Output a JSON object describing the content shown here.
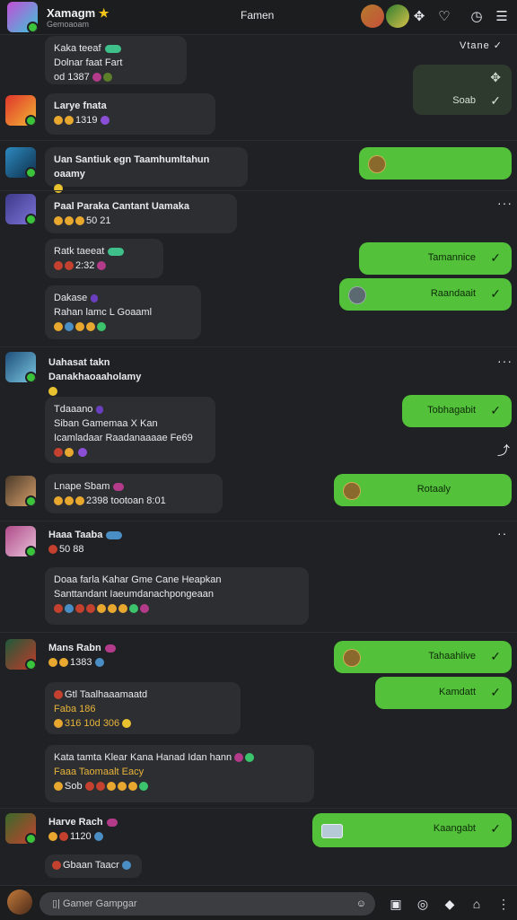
{
  "header": {
    "title": "Xamagm",
    "subtitle": "Gemoaoam",
    "center": "Famen",
    "time": "Vtane"
  },
  "rows": [
    {
      "name": "Kaka teeaf",
      "line2": "Dolnar faat Fart",
      "line3": "od 1387"
    },
    {
      "name": "Larye fnata",
      "sub": "1319"
    },
    {
      "name": "Uan Santiuk egn Taamhumltahun oaamy",
      "out": ""
    },
    {
      "name": "Paal Paraka Cantant Uamaka",
      "sub": "50 21"
    },
    {
      "name": "Ratk taeeat",
      "sub": "2:32",
      "out": "Tamannice"
    },
    {
      "name": "Dakase",
      "line2": "Rahan lamc L Goaaml",
      "out": "Raandaait"
    },
    {
      "name": "Uahasat takn Danakhaoaaholamy"
    },
    {
      "name": "Tdaaano",
      "line2": "Siban Gamemaa X Kan",
      "line3": "Icamladaar Raadanaaaae Fe69",
      "out": "Tobhagabit"
    },
    {
      "name": "Lnape Sbam",
      "sub": "2398 tootoan 8:01",
      "out": "Rotaaly"
    },
    {
      "name": "Haaa Taaba",
      "sub": "50 88"
    },
    {
      "name": "Doaa farla Kahar Gme Cane Heapkan",
      "line2": "Santtandant Iaeumdanachpongeaan"
    },
    {
      "name": "Mans Rabn",
      "sub": "1383",
      "out": "Tahaahlive"
    },
    {
      "name": "Gtl Taalhaaamaatd",
      "line2": "Faba 186",
      "line3": "316 10d 306",
      "out": "Kamdatt"
    },
    {
      "name": "Kata tamta Klear Kana Hanad Idan hann",
      "line2": "Faaa Taomaalt Eacy",
      "line3": "Sob"
    },
    {
      "name": "Harve Rach",
      "sub": "1120",
      "out": "Kaangabt"
    },
    {
      "name": "Gbaan Taacr"
    }
  ],
  "composer": {
    "placeholder": "Gamer Gampgar"
  },
  "colors": {
    "accent": "#53c23a",
    "bg": "#202124",
    "bubble": "#2d2e31"
  }
}
